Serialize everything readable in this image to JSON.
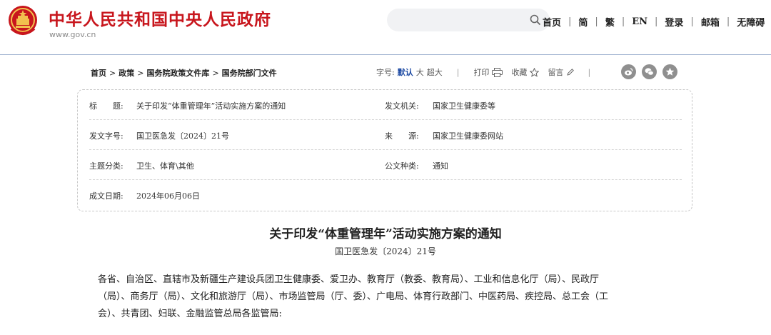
{
  "header": {
    "site_title": "中华人民共和国中央人民政府",
    "site_url": "www.gov.cn",
    "brand_color": "#c8161d",
    "nav": [
      "首页",
      "简",
      "繁",
      "EN",
      "登录",
      "邮箱",
      "无障碍"
    ]
  },
  "toolbar": {
    "breadcrumb": [
      "首页",
      "政策",
      "国务院政策文件库",
      "国务院部门文件"
    ],
    "breadcrumb_sep": ">",
    "font_size_label": "字号:",
    "font_size_default": "默认",
    "font_size_large": "大",
    "font_size_xlarge": "超大",
    "divider": "|",
    "print_label": "打印",
    "favorite_label": "收藏",
    "comment_label": "留言",
    "share_icons": [
      "weibo-icon",
      "wechat-icon",
      "qzone-icon"
    ]
  },
  "meta": {
    "title_label": "标　　题:",
    "title_value": "关于印发“体重管理年”活动实施方案的通知",
    "issuer_label": "发文机关:",
    "issuer_value": "国家卫生健康委等",
    "doc_no_label": "发文字号:",
    "doc_no_value": "国卫医急发〔2024〕21号",
    "source_label": "来　　源:",
    "source_value": "国家卫生健康委网站",
    "category_label": "主题分类:",
    "category_value": "卫生、体育\\其他",
    "doc_type_label": "公文种类:",
    "doc_type_value": "通知",
    "date_label": "成文日期:",
    "date_value": "2024年06月06日"
  },
  "document": {
    "title": "关于印发“体重管理年”活动实施方案的通知",
    "number": "国卫医急发〔2024〕21号",
    "body_lines": [
      "各省、自治区、直辖市及新疆生产建设兵团卫生健康委、爱卫办、教育厅（教委、教育局）、工业和信息化厅（局）、民政厅",
      "（局）、商务厅（局）、文化和旅游厅（局）、市场监管局（厅、委）、广电局、体育行政部门、中医药局、疾控局、总工会（工",
      "会）、共青团、妇联、金融监管总局各监管局:"
    ]
  }
}
